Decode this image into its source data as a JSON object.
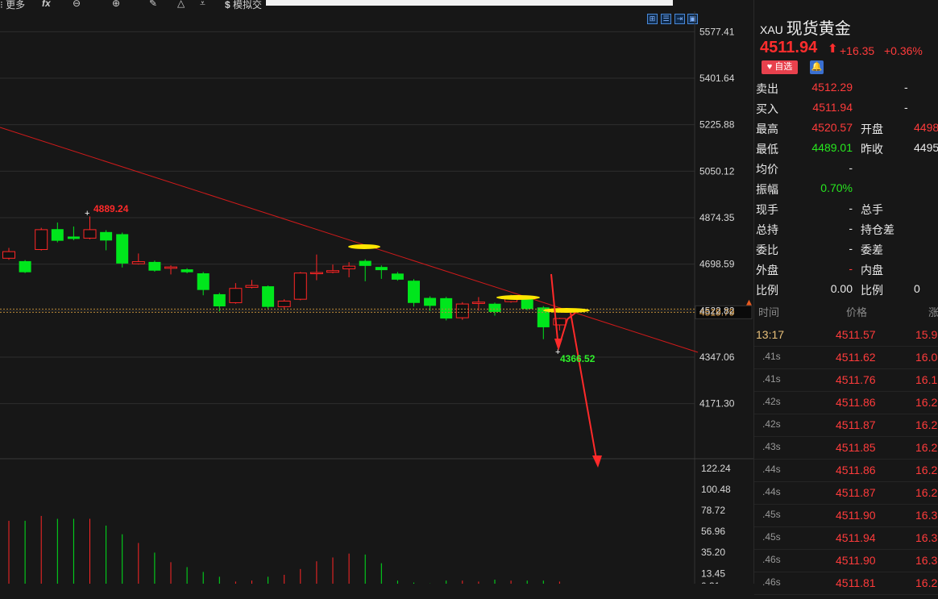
{
  "toolbar": {
    "more_label": "更多",
    "sim_label": "模拟交"
  },
  "chart_data": {
    "type": "candlestick",
    "title": "",
    "y_axis_ticks": [
      5577.41,
      5401.64,
      5225.88,
      5050.12,
      4874.35,
      4698.59,
      4522.82,
      4347.06,
      4171.3
    ],
    "current_price_marker": "4519.79",
    "annotations": {
      "high_label": "4889.24",
      "low_label": "4366.52"
    },
    "candles": [
      {
        "o": 4721,
        "c": 4746,
        "h": 4760,
        "l": 4715
      },
      {
        "o": 4710,
        "c": 4668,
        "h": 4714,
        "l": 4665
      },
      {
        "o": 4754,
        "c": 4829,
        "h": 4836,
        "l": 4750
      },
      {
        "o": 4831,
        "c": 4787,
        "h": 4856,
        "l": 4781
      },
      {
        "o": 4803,
        "c": 4794,
        "h": 4841,
        "l": 4789
      },
      {
        "o": 4797,
        "c": 4829,
        "h": 4879,
        "l": 4793
      },
      {
        "o": 4820,
        "c": 4788,
        "h": 4827,
        "l": 4751
      },
      {
        "o": 4812,
        "c": 4701,
        "h": 4818,
        "l": 4686
      },
      {
        "o": 4700,
        "c": 4708,
        "h": 4739,
        "l": 4697
      },
      {
        "o": 4707,
        "c": 4674,
        "h": 4712,
        "l": 4670
      },
      {
        "o": 4683,
        "c": 4688,
        "h": 4694,
        "l": 4660
      },
      {
        "o": 4679,
        "c": 4668,
        "h": 4683,
        "l": 4664
      },
      {
        "o": 4664,
        "c": 4601,
        "h": 4669,
        "l": 4581
      },
      {
        "o": 4585,
        "c": 4539,
        "h": 4590,
        "l": 4520
      },
      {
        "o": 4553,
        "c": 4607,
        "h": 4627,
        "l": 4549
      },
      {
        "o": 4611,
        "c": 4618,
        "h": 4639,
        "l": 4607
      },
      {
        "o": 4615,
        "c": 4537,
        "h": 4618,
        "l": 4530
      },
      {
        "o": 4538,
        "c": 4559,
        "h": 4566,
        "l": 4528
      },
      {
        "o": 4566,
        "c": 4665,
        "h": 4669,
        "l": 4562
      },
      {
        "o": 4667,
        "c": 4667,
        "h": 4735,
        "l": 4638
      },
      {
        "o": 4668,
        "c": 4674,
        "h": 4697,
        "l": 4664
      },
      {
        "o": 4681,
        "c": 4691,
        "h": 4706,
        "l": 4649
      },
      {
        "o": 4711,
        "c": 4692,
        "h": 4717,
        "l": 4634
      },
      {
        "o": 4688,
        "c": 4676,
        "h": 4694,
        "l": 4643
      },
      {
        "o": 4663,
        "c": 4640,
        "h": 4669,
        "l": 4636
      },
      {
        "o": 4636,
        "c": 4552,
        "h": 4642,
        "l": 4538
      },
      {
        "o": 4571,
        "c": 4541,
        "h": 4577,
        "l": 4522
      },
      {
        "o": 4570,
        "c": 4493,
        "h": 4575,
        "l": 4486
      },
      {
        "o": 4496,
        "c": 4548,
        "h": 4555,
        "l": 4488
      },
      {
        "o": 4550,
        "c": 4555,
        "h": 4574,
        "l": 4523
      },
      {
        "o": 4549,
        "c": 4518,
        "h": 4553,
        "l": 4504
      },
      {
        "o": 4557,
        "c": 4576,
        "h": 4583,
        "l": 4553
      },
      {
        "o": 4572,
        "c": 4529,
        "h": 4577,
        "l": 4525
      },
      {
        "o": 4535,
        "c": 4460,
        "h": 4540,
        "l": 4415
      },
      {
        "o": 4469,
        "c": 4493,
        "h": 4496,
        "l": 4448
      }
    ],
    "volume_axis_ticks": [
      122.24,
      100.48,
      78.72,
      56.96,
      35.2,
      13.45,
      0.31
    ],
    "volume": [
      68,
      68,
      73,
      70,
      70,
      70,
      63,
      54,
      45,
      35,
      25,
      20,
      15,
      10,
      5,
      6,
      10,
      12,
      18,
      26,
      30,
      34,
      33,
      24,
      6,
      4,
      3,
      6,
      6,
      5,
      7,
      6,
      6,
      6,
      5
    ]
  },
  "quote": {
    "code": "XAU",
    "name": "现货黄金",
    "price": "4511.94",
    "change": "+16.35",
    "change_pct": "+0.36%",
    "fav_label": "自选",
    "rows": [
      {
        "l1": "卖出",
        "v1": "4512.29",
        "v1c": "r",
        "l2": "",
        "v2": "-",
        "v2c": "w"
      },
      {
        "l1": "买入",
        "v1": "4511.94",
        "v1c": "r",
        "l2": "",
        "v2": "-",
        "v2c": "w"
      },
      {
        "l1": "最高",
        "v1": "4520.57",
        "v1c": "r",
        "l2": "开盘",
        "v2": "4498",
        "v2c": "r"
      },
      {
        "l1": "最低",
        "v1": "4489.01",
        "v1c": "g",
        "l2": "昨收",
        "v2": "4495",
        "v2c": "w"
      },
      {
        "l1": "均价",
        "v1": "-",
        "v1c": "w",
        "l2": "",
        "v2": "",
        "v2c": "w"
      },
      {
        "l1": "振幅",
        "v1": "0.70%",
        "v1c": "g",
        "l2": "",
        "v2": "",
        "v2c": "w"
      },
      {
        "l1": "现手",
        "v1": "-",
        "v1c": "w",
        "l2": "总手",
        "v2": "",
        "v2c": "w"
      },
      {
        "l1": "总持",
        "v1": "-",
        "v1c": "w",
        "l2": "持仓差",
        "v2": "",
        "v2c": "w"
      },
      {
        "l1": "委比",
        "v1": "-",
        "v1c": "w",
        "l2": "委差",
        "v2": "",
        "v2c": "w"
      },
      {
        "l1": "外盘",
        "v1": "-",
        "v1c": "r",
        "l2": "内盘",
        "v2": "",
        "v2c": "w"
      },
      {
        "l1": "比例",
        "v1": "0.00",
        "v1c": "w",
        "l2": "比例",
        "v2": "0",
        "v2c": "w"
      }
    ]
  },
  "ticks": {
    "headers": [
      "时间",
      "价格",
      "涨"
    ],
    "rows": [
      {
        "time": "13:17",
        "price": "4511.57",
        "vol": "15.9"
      },
      {
        "time": ".41s",
        "price": "4511.62",
        "vol": "16.0"
      },
      {
        "time": ".41s",
        "price": "4511.76",
        "vol": "16.1"
      },
      {
        "time": ".42s",
        "price": "4511.86",
        "vol": "16.2"
      },
      {
        "time": ".42s",
        "price": "4511.87",
        "vol": "16.2"
      },
      {
        "time": ".43s",
        "price": "4511.85",
        "vol": "16.2"
      },
      {
        "time": ".44s",
        "price": "4511.86",
        "vol": "16.2"
      },
      {
        "time": ".44s",
        "price": "4511.87",
        "vol": "16.2"
      },
      {
        "time": ".45s",
        "price": "4511.90",
        "vol": "16.3"
      },
      {
        "time": ".45s",
        "price": "4511.94",
        "vol": "16.3"
      },
      {
        "time": ".46s",
        "price": "4511.90",
        "vol": "16.3"
      },
      {
        "time": ".46s",
        "price": "4511.81",
        "vol": "16.2"
      }
    ]
  },
  "colors": {
    "up": "#ff2626",
    "down": "#00e61c",
    "bg": "#171717",
    "grid": "#2e2e2e",
    "highlight": "#ffe600"
  }
}
